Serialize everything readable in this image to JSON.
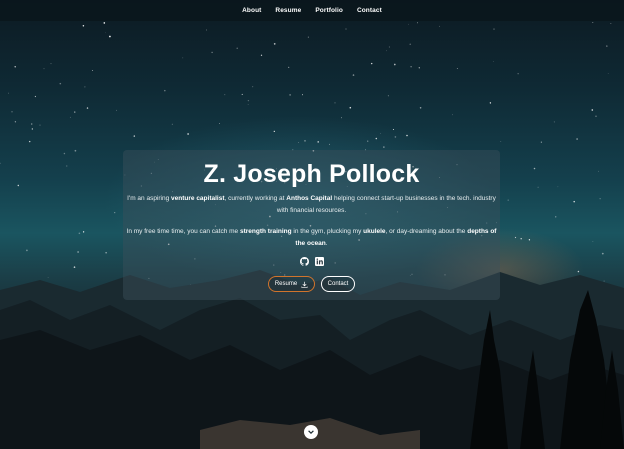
{
  "nav": {
    "items": [
      {
        "label": "About"
      },
      {
        "label": "Resume"
      },
      {
        "label": "Portfolio"
      },
      {
        "label": "Contact"
      }
    ]
  },
  "hero": {
    "name": "Z. Joseph Pollock",
    "bio1": {
      "t1": "I'm an aspiring ",
      "b1": "venture capitalist",
      "t2": ", currently working at ",
      "b2": "Anthos Capital",
      "t3": " helping connect start-up businesses in the tech. industry with financial resources."
    },
    "bio2": {
      "t1": "In my free time time, you can catch me ",
      "b1": "strength training",
      "t2": " in the gym, plucking my ",
      "b2": "ukulele",
      "t3": ", or day-dreaming about the ",
      "b3": "depths of the ocean",
      "t4": "."
    },
    "socials": [
      {
        "icon": "github-icon"
      },
      {
        "icon": "linkedin-icon"
      }
    ],
    "buttons": {
      "resume_label": "Resume",
      "contact_label": "Contact"
    }
  },
  "colors": {
    "accent_orange": "#d1742c",
    "nav_bg": "#0a161c"
  }
}
